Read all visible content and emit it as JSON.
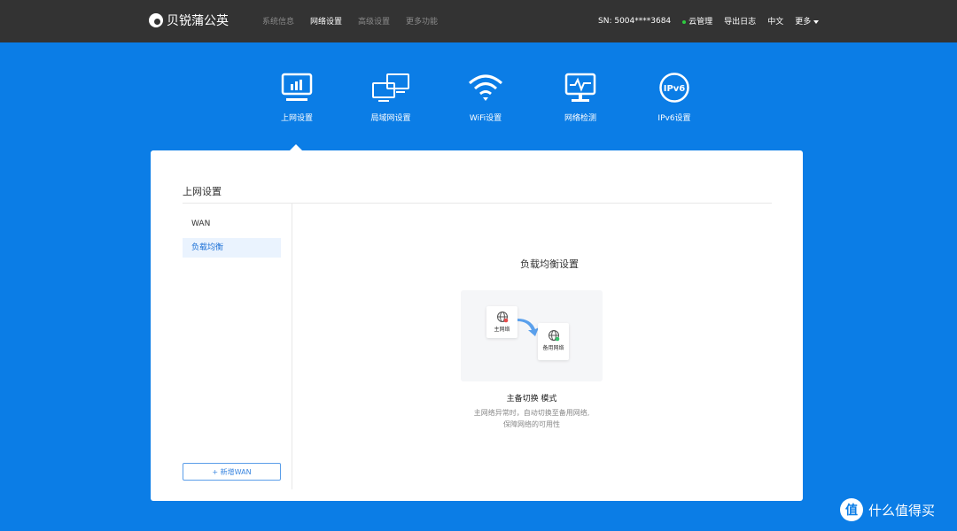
{
  "header": {
    "logo_text": "贝锐蒲公英",
    "nav": [
      "系统信息",
      "网络设置",
      "高级设置",
      "更多功能"
    ],
    "sn": "SN:  5004****3684",
    "cloud": "云管理",
    "export_log": "导出日志",
    "lang": "中文",
    "more": "更多"
  },
  "categories": [
    {
      "label": "上网设置",
      "icon": "monitor-chart-icon"
    },
    {
      "label": "局域网设置",
      "icon": "lan-monitors-icon"
    },
    {
      "label": "WiFi设置",
      "icon": "wifi-icon"
    },
    {
      "label": "网络检测",
      "icon": "network-monitor-icon"
    },
    {
      "label": "IPv6设置",
      "icon": "ipv6-icon"
    }
  ],
  "ipv6_icon_text": "IPv6",
  "card": {
    "title": "上网设置",
    "sidebar": [
      "WAN",
      "负载均衡"
    ],
    "add_button": "+ 新增WAN",
    "content_title": "负载均衡设置",
    "primary_label": "主网络",
    "backup_label": "备用网络",
    "mode_title": "主备切换 模式",
    "mode_desc_1": "主网络异常时，自动切换至备用网络,",
    "mode_desc_2": "保障网络的可用性"
  },
  "watermark": {
    "logo": "值",
    "text": "什么值得买"
  },
  "colors": {
    "accent": "#0b7de6",
    "topbar": "#333333"
  }
}
